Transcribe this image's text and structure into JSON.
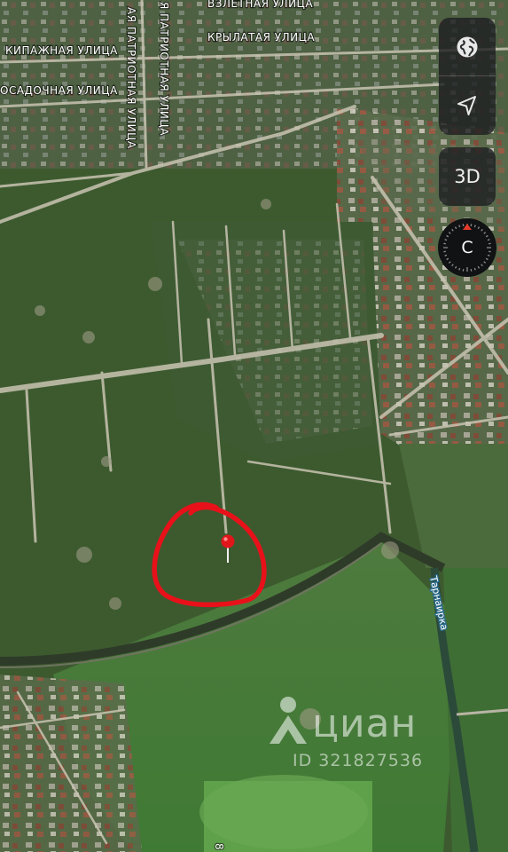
{
  "map": {
    "type": "satellite",
    "streets": {
      "vzletnaya": "ВЗЛЕТНАЯ УЛИЦА",
      "krylataya": "КРЫЛАТАЯ УЛИЦА",
      "ekipazhnaya": "КИПАЖНАЯ УЛИЦА",
      "posadochnaya": "ОСАДОЧНАЯ УЛИЦА",
      "patriotnaya_1": "Я ПАТРИОТНАЯ УЛИЦА",
      "patriotnaya_2": "АЯ ПАТРИОТНАЯ УЛИЦА",
      "bottom_fragment": "8"
    },
    "river": "Тарнаирка",
    "marker": {
      "icon": "map-pin-icon",
      "color": "#e0161b"
    },
    "annotation": {
      "shape": "hand-drawn-circle",
      "color": "#e8111a"
    }
  },
  "controls": {
    "globe_icon": "globe-icon",
    "location_icon": "location-arrow-icon",
    "mode_3d_label": "3D",
    "compass_label": "С"
  },
  "watermark": {
    "brand": "циан",
    "listing_id": "ID 321827536"
  }
}
